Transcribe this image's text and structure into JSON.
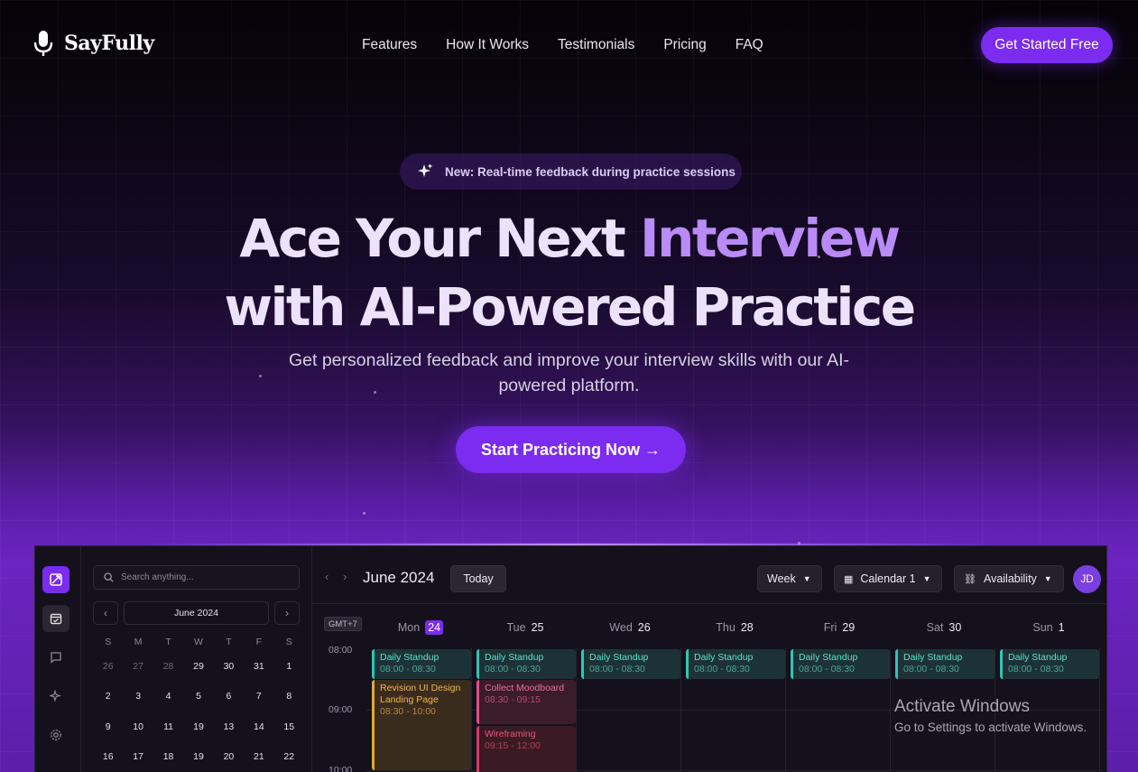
{
  "brand": {
    "name": "SayFully",
    "icon": "microphone-icon"
  },
  "nav": {
    "links": [
      "Features",
      "How It Works",
      "Testimonials",
      "Pricing",
      "FAQ"
    ],
    "cta_label": "Get Started Free"
  },
  "hero": {
    "badge_icon": "sparkles-icon",
    "badge_text": "New: Real-time feedback during practice sessions",
    "title_part1": "Ace Your Next ",
    "title_accent": "Interview",
    "title_line2": "with AI-Powered Practice",
    "subtitle": "Get personalized feedback and improve your interview skills with our AI-powered platform.",
    "cta_label": "Start Practicing Now →"
  },
  "preview": {
    "search_placeholder": "Search anything...",
    "mini_month": "June 2024",
    "weekday_initials": [
      "S",
      "M",
      "T",
      "W",
      "T",
      "F",
      "S"
    ],
    "mini_days": [
      {
        "d": "26",
        "muted": true
      },
      {
        "d": "27",
        "muted": true
      },
      {
        "d": "28",
        "muted": true
      },
      {
        "d": "29"
      },
      {
        "d": "30"
      },
      {
        "d": "31"
      },
      {
        "d": "1"
      },
      {
        "d": "2"
      },
      {
        "d": "3"
      },
      {
        "d": "4"
      },
      {
        "d": "5"
      },
      {
        "d": "6"
      },
      {
        "d": "7"
      },
      {
        "d": "8"
      },
      {
        "d": "9"
      },
      {
        "d": "10"
      },
      {
        "d": "11"
      },
      {
        "d": "19"
      },
      {
        "d": "13"
      },
      {
        "d": "14"
      },
      {
        "d": "15"
      },
      {
        "d": "16"
      },
      {
        "d": "17"
      },
      {
        "d": "18"
      },
      {
        "d": "19"
      },
      {
        "d": "20"
      },
      {
        "d": "21"
      },
      {
        "d": "22"
      }
    ],
    "month_title": "June 2024",
    "today_label": "Today",
    "view_label": "Week",
    "calendar_label": "Calendar 1",
    "availability_label": "Availability",
    "avatar_initials": "JD",
    "timezone": "GMT+7",
    "days": [
      {
        "name": "Mon",
        "num": "24",
        "current": true
      },
      {
        "name": "Tue",
        "num": "25"
      },
      {
        "name": "Wed",
        "num": "26"
      },
      {
        "name": "Thu",
        "num": "28"
      },
      {
        "name": "Fri",
        "num": "29"
      },
      {
        "name": "Sat",
        "num": "30"
      },
      {
        "name": "Sun",
        "num": "1"
      }
    ],
    "hours": [
      "08:00",
      "09:00",
      "10:00"
    ],
    "standup": {
      "title": "Daily Standup",
      "time": "08:00 - 08:30"
    },
    "events": {
      "revision": {
        "title": "Revision UI Design Landing Page",
        "time": "08:30 - 10:00"
      },
      "moodboard": {
        "title": "Collect Moodboard",
        "time": "08:30 - 09:15"
      },
      "wireframing": {
        "title": "Wireframing",
        "time": "09:15 - 12:00"
      }
    },
    "colors": {
      "accent": "#7b2cf0",
      "teal": "#2cc6b7",
      "amber": "#e8a33a",
      "pink": "#e94b86"
    }
  },
  "watermark": {
    "line1": "Activate Windows",
    "line2": "Go to Settings to activate Windows."
  }
}
